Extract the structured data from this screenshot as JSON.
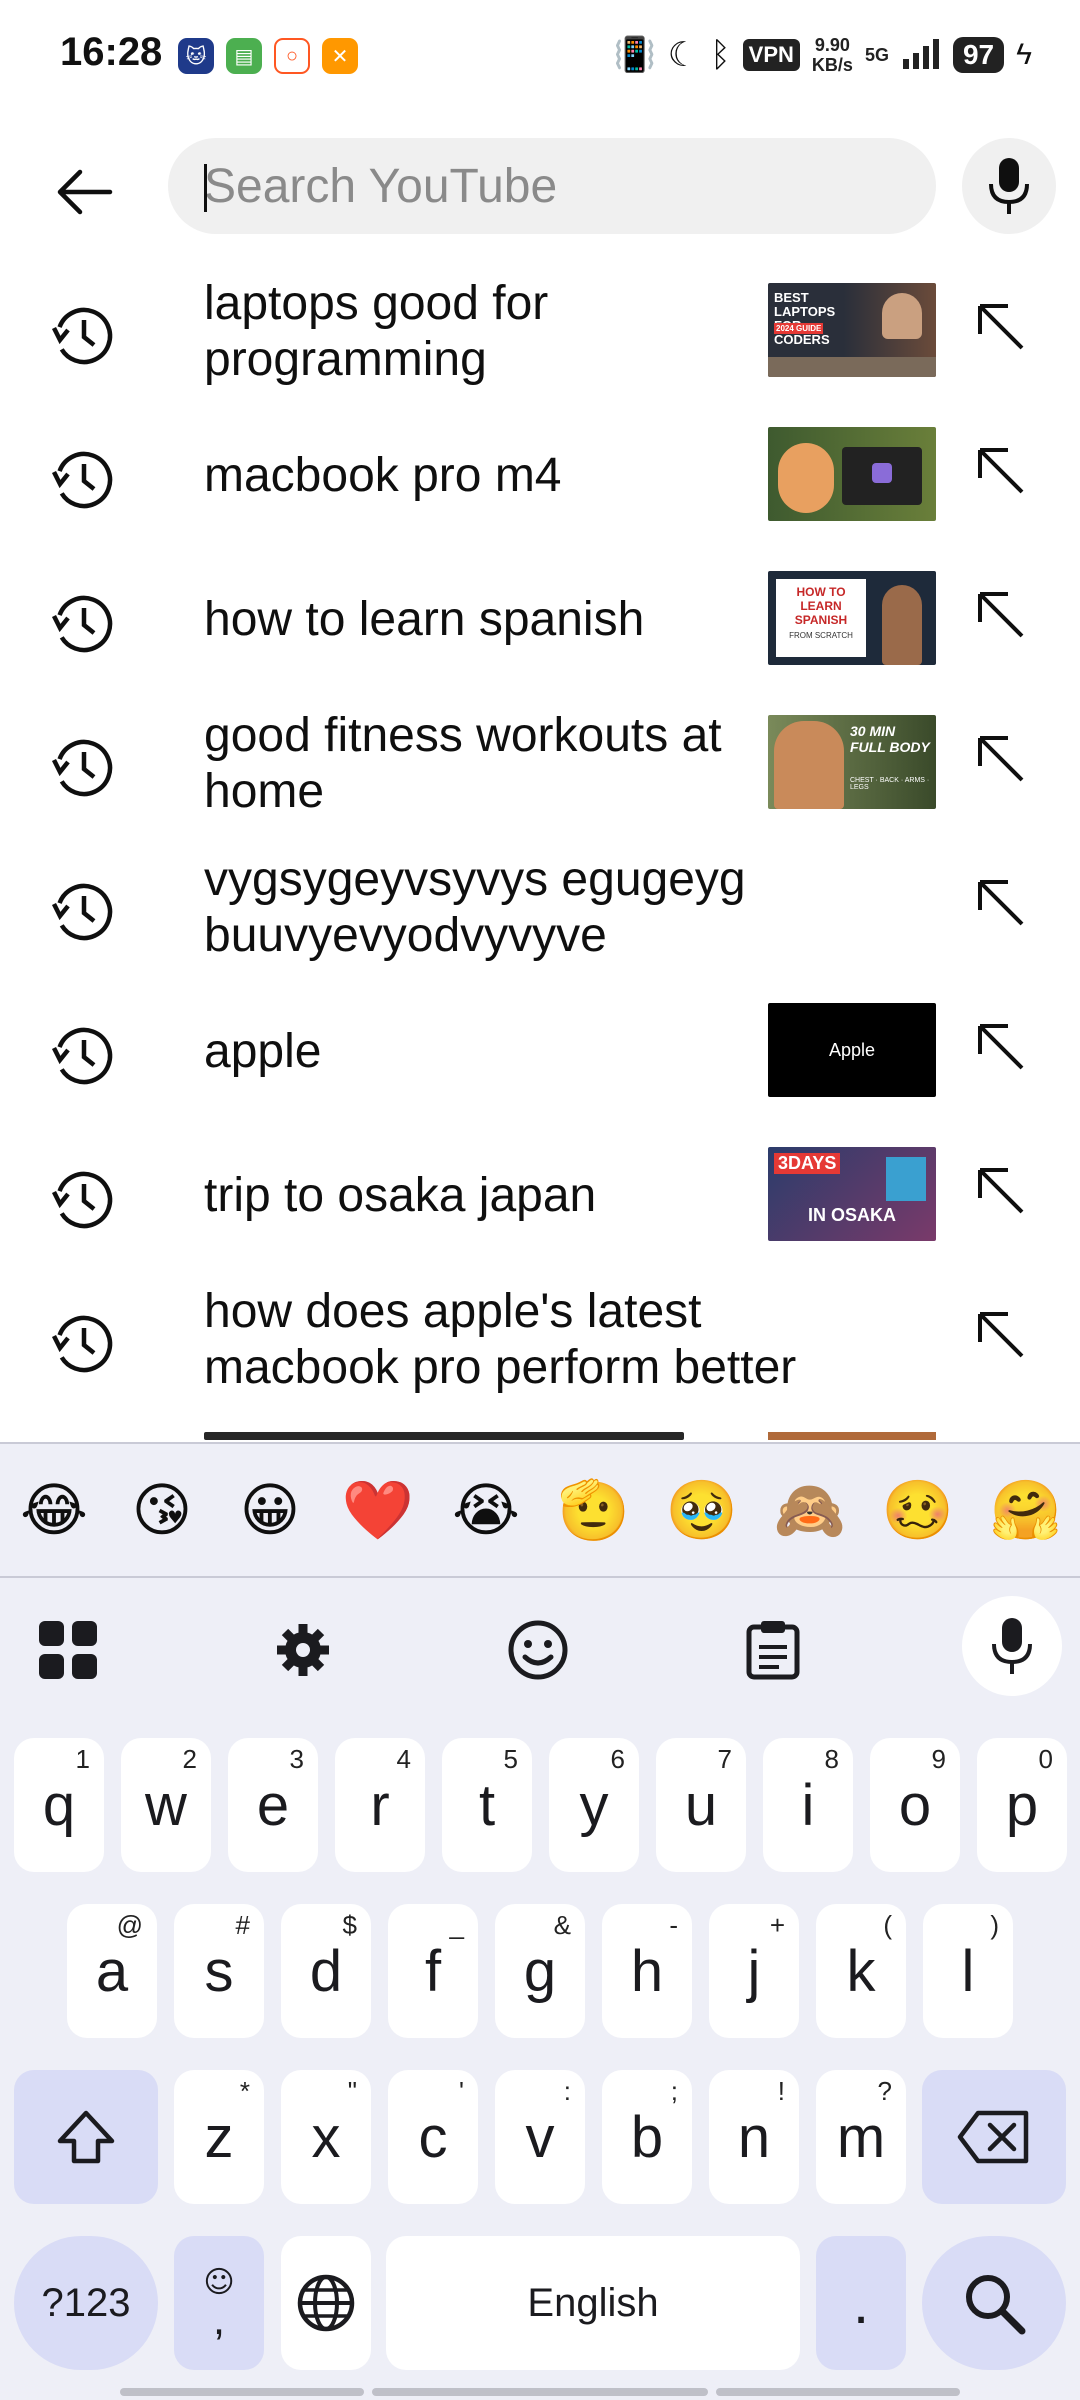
{
  "status_bar": {
    "time": "16:28",
    "vpn": "VPN",
    "speed_value": "9.90",
    "speed_unit": "KB/s",
    "network": "5G",
    "battery": "97"
  },
  "search": {
    "placeholder": "Search YouTube",
    "value": ""
  },
  "suggestions": [
    {
      "text": "laptops good for programming",
      "thumb_text": "BEST LAPTOPS FOR CODERS",
      "thumb_sub": "2024 GUIDE",
      "thumb_bg": "#2a2f3a"
    },
    {
      "text": "macbook pro m4",
      "thumb_text": "",
      "thumb_sub": "",
      "thumb_bg": "#3e5a2f"
    },
    {
      "text": "how to learn spanish",
      "thumb_text": "HOW TO LEARN SPANISH",
      "thumb_sub": "FROM SCRATCH",
      "thumb_bg": "#1e2a3a"
    },
    {
      "text": "good fitness workouts at home",
      "thumb_text": "30 MIN FULL BODY",
      "thumb_sub": "CHEST · BACK · ARMS · LEGS",
      "thumb_bg": "#4b5a3a"
    },
    {
      "text": "vygsygeyvsyvys egugeyg buuvyevyodvyvyve",
      "thumb_text": "",
      "thumb_sub": "",
      "thumb_bg": ""
    },
    {
      "text": "apple",
      "thumb_text": "Apple",
      "thumb_sub": "",
      "thumb_bg": "#000000"
    },
    {
      "text": "trip to osaka japan",
      "thumb_text": "3DAYS",
      "thumb_sub": "IN OSAKA",
      "thumb_bg": "#2b3c6b"
    },
    {
      "text": "how does apple's latest macbook pro perform better",
      "thumb_text": "",
      "thumb_sub": "",
      "thumb_bg": ""
    }
  ],
  "emoji_bar": [
    "😂",
    "😘",
    "😀",
    "❤️",
    "😭",
    "🫡",
    "🥹",
    "🙈",
    "🥴",
    "🤗"
  ],
  "keyboard": {
    "row1": [
      {
        "k": "q",
        "h": "1"
      },
      {
        "k": "w",
        "h": "2"
      },
      {
        "k": "e",
        "h": "3"
      },
      {
        "k": "r",
        "h": "4"
      },
      {
        "k": "t",
        "h": "5"
      },
      {
        "k": "y",
        "h": "6"
      },
      {
        "k": "u",
        "h": "7"
      },
      {
        "k": "i",
        "h": "8"
      },
      {
        "k": "o",
        "h": "9"
      },
      {
        "k": "p",
        "h": "0"
      }
    ],
    "row2": [
      {
        "k": "a",
        "h": "@"
      },
      {
        "k": "s",
        "h": "#"
      },
      {
        "k": "d",
        "h": "$"
      },
      {
        "k": "f",
        "h": "_"
      },
      {
        "k": "g",
        "h": "&"
      },
      {
        "k": "h",
        "h": "-"
      },
      {
        "k": "j",
        "h": "+"
      },
      {
        "k": "k",
        "h": "("
      },
      {
        "k": "l",
        "h": ")"
      }
    ],
    "row3": [
      {
        "k": "z",
        "h": "*"
      },
      {
        "k": "x",
        "h": "\""
      },
      {
        "k": "c",
        "h": "'"
      },
      {
        "k": "v",
        "h": ":"
      },
      {
        "k": "b",
        "h": ";"
      },
      {
        "k": "n",
        "h": "!"
      },
      {
        "k": "m",
        "h": "?"
      }
    ],
    "symbols_label": "?123",
    "comma_label": ",",
    "space_label": "English",
    "period_label": "."
  },
  "colors": {
    "accent_key": "#d9dcf6",
    "keyboard_bg": "#eeeff7"
  }
}
